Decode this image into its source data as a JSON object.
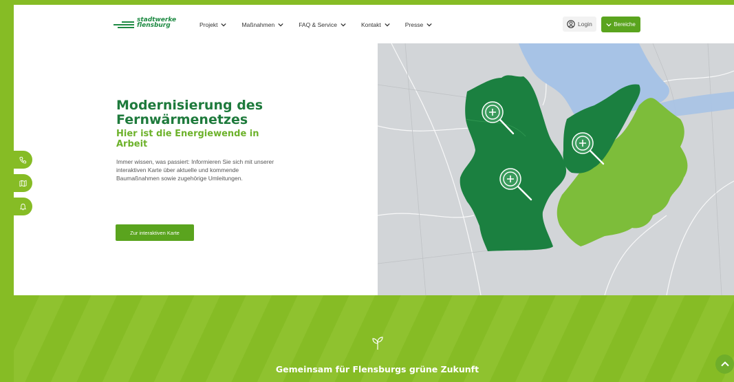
{
  "brand": {
    "name_line1": "stadtwerke",
    "name_line2": "flensburg",
    "color": "#1e8a43",
    "accent": "#86bc25"
  },
  "nav": {
    "items": [
      {
        "label": "Projekt"
      },
      {
        "label": "Maßnahmen"
      },
      {
        "label": "FAQ & Service"
      },
      {
        "label": "Kontakt"
      },
      {
        "label": "Presse"
      }
    ],
    "login_label": "Login",
    "bereiche_label": "Bereiche"
  },
  "hero": {
    "title": "Modernisierung des Fernwärmenetzes",
    "subtitle": "Hier ist die Energiewende in Arbeit",
    "description": "Immer wissen, was passiert: Informieren Sie sich mit unserer interaktiven Karte über aktuelle und kommende Baumaßnahmen sowie zugehörige Umleitungen.",
    "cta_label": "Zur interaktiven Karte"
  },
  "map": {
    "regions": [
      "dark-green-region-west",
      "dark-green-region-east",
      "light-green-region-east"
    ],
    "zoom_icons": [
      "zoom-in-icon",
      "zoom-in-icon",
      "zoom-in-icon"
    ],
    "colors": {
      "dark": "#1b8040",
      "light": "#7dbd3a",
      "water": "#a7c3e6",
      "land": "#d4d7d9"
    }
  },
  "side_tabs": [
    {
      "icon": "phone-icon"
    },
    {
      "icon": "map-icon"
    },
    {
      "icon": "bell-icon"
    }
  ],
  "banner": {
    "icon": "sprout-icon",
    "title": "Gemeinsam für Flensburgs grüne Zukunft"
  },
  "scroll_top": {
    "icon": "chevron-up-icon"
  }
}
